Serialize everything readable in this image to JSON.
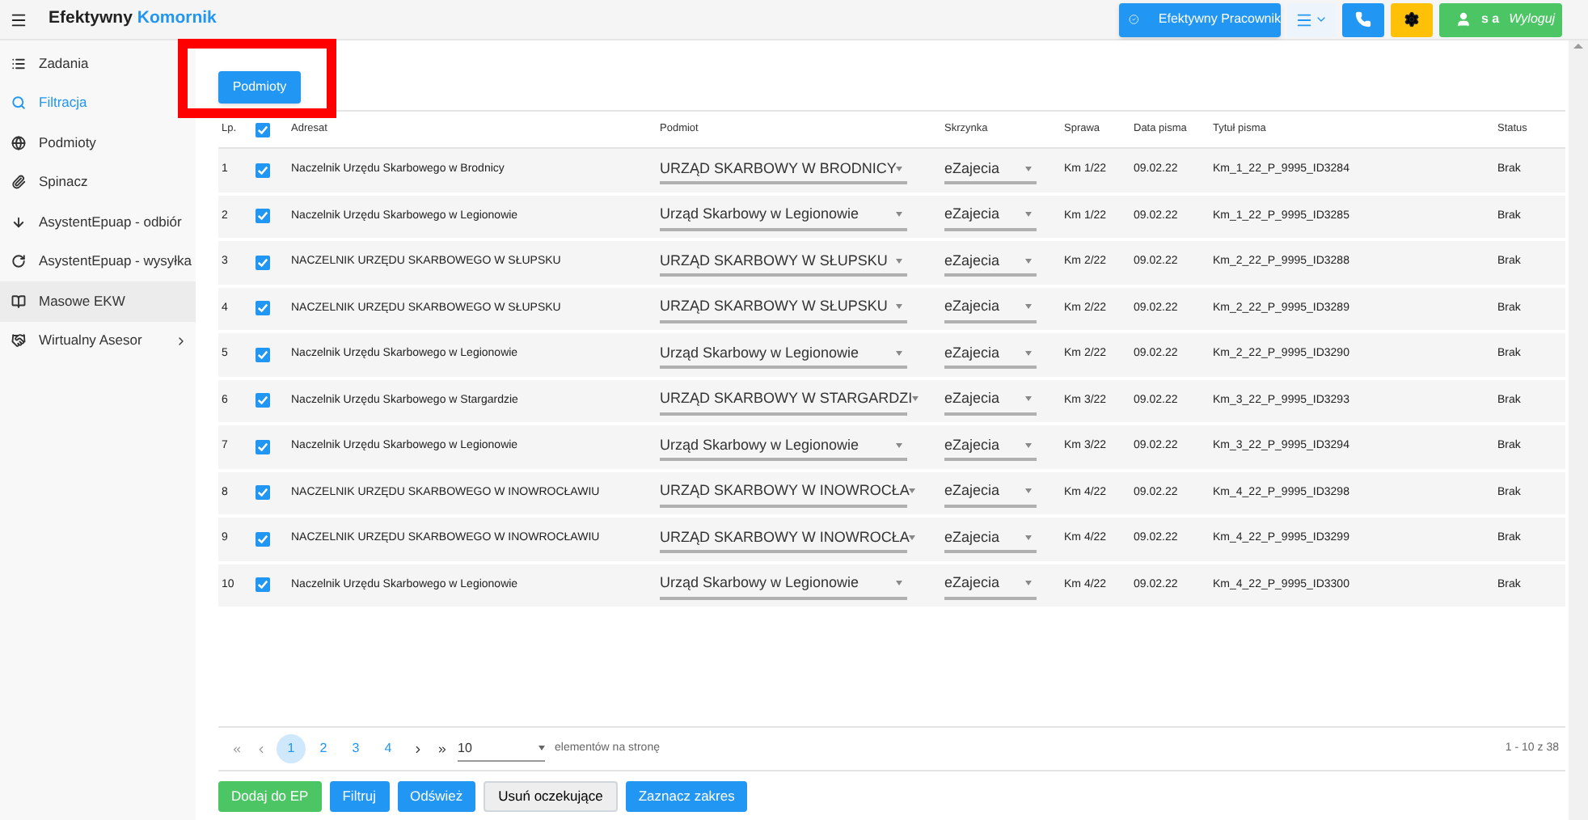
{
  "app": {
    "title_part1": "Efektywny",
    "title_part2": "Komornik"
  },
  "header_buttons": [
    {
      "kind": "primary",
      "label": "Efektywny Pracownik"
    },
    {
      "kind": "menu"
    },
    {
      "kind": "phone"
    },
    {
      "kind": "settings"
    },
    {
      "kind": "user",
      "user": "s a",
      "action": "Wyloguj"
    }
  ],
  "sidebar": {
    "items": [
      {
        "label": "Zadania",
        "selected": false,
        "highlighted": false
      },
      {
        "label": "Filtracja",
        "selected": true,
        "highlighted": false
      },
      {
        "label": "Podmioty",
        "selected": false,
        "highlighted": false
      },
      {
        "label": "Spinacz",
        "selected": false,
        "highlighted": false
      },
      {
        "label": "AsystentEpuap - odbiór",
        "selected": false,
        "highlighted": false
      },
      {
        "label": "AsystentEpuap - wysyłka",
        "selected": false,
        "highlighted": false
      },
      {
        "label": "Masowe EKW",
        "selected": false,
        "highlighted": true
      },
      {
        "label": "Wirtualny Asesor",
        "selected": false,
        "highlighted": false,
        "has_children": true
      }
    ]
  },
  "top_button": "Podmioty",
  "table": {
    "columns": [
      "Lp.",
      "Adresat",
      "Podmiot",
      "Skrzynka",
      "Sprawa",
      "Data pisma",
      "Tytuł pisma",
      "Status"
    ],
    "all_checked": true,
    "rows": [
      {
        "lp": "1",
        "checked": true,
        "adresat": "Naczelnik Urzędu Skarbowego w Brodnicy",
        "podmiot": "URZĄD SKARBOWY W BRODNICY",
        "skrzynka": "eZajecia",
        "sprawa": "Km 1/22",
        "data": "09.02.22",
        "tytul": "Km_1_22_P_9995_ID3284",
        "status": "Brak"
      },
      {
        "lp": "2",
        "checked": true,
        "adresat": "Naczelnik Urzędu Skarbowego w Legionowie",
        "podmiot": "Urząd Skarbowy w Legionowie",
        "skrzynka": "eZajecia",
        "sprawa": "Km 1/22",
        "data": "09.02.22",
        "tytul": "Km_1_22_P_9995_ID3285",
        "status": "Brak"
      },
      {
        "lp": "3",
        "checked": true,
        "adresat": "NACZELNIK URZĘDU SKARBOWEGO W SŁUPSKU",
        "podmiot": "URZĄD SKARBOWY W SŁUPSKU",
        "skrzynka": "eZajecia",
        "sprawa": "Km 2/22",
        "data": "09.02.22",
        "tytul": "Km_2_22_P_9995_ID3288",
        "status": "Brak"
      },
      {
        "lp": "4",
        "checked": true,
        "adresat": "NACZELNIK URZĘDU SKARBOWEGO W SŁUPSKU",
        "podmiot": "URZĄD SKARBOWY W SŁUPSKU",
        "skrzynka": "eZajecia",
        "sprawa": "Km 2/22",
        "data": "09.02.22",
        "tytul": "Km_2_22_P_9995_ID3289",
        "status": "Brak"
      },
      {
        "lp": "5",
        "checked": true,
        "adresat": "Naczelnik Urzędu Skarbowego w Legionowie",
        "podmiot": "Urząd Skarbowy w Legionowie",
        "skrzynka": "eZajecia",
        "sprawa": "Km 2/22",
        "data": "09.02.22",
        "tytul": "Km_2_22_P_9995_ID3290",
        "status": "Brak"
      },
      {
        "lp": "6",
        "checked": true,
        "adresat": "Naczelnik Urzędu Skarbowego w Stargardzie",
        "podmiot": "URZĄD SKARBOWY W STARGARDZI",
        "skrzynka": "eZajecia",
        "sprawa": "Km 3/22",
        "data": "09.02.22",
        "tytul": "Km_3_22_P_9995_ID3293",
        "status": "Brak"
      },
      {
        "lp": "7",
        "checked": true,
        "adresat": "Naczelnik Urzędu Skarbowego w Legionowie",
        "podmiot": "Urząd Skarbowy w Legionowie",
        "skrzynka": "eZajecia",
        "sprawa": "Km 3/22",
        "data": "09.02.22",
        "tytul": "Km_3_22_P_9995_ID3294",
        "status": "Brak"
      },
      {
        "lp": "8",
        "checked": true,
        "adresat": "NACZELNIK URZĘDU SKARBOWEGO W INOWROCŁAWIU",
        "podmiot": "URZĄD SKARBOWY W INOWROCŁA",
        "skrzynka": "eZajecia",
        "sprawa": "Km 4/22",
        "data": "09.02.22",
        "tytul": "Km_4_22_P_9995_ID3298",
        "status": "Brak"
      },
      {
        "lp": "9",
        "checked": true,
        "adresat": "NACZELNIK URZĘDU SKARBOWEGO W INOWROCŁAWIU",
        "podmiot": "URZĄD SKARBOWY W INOWROCŁA",
        "skrzynka": "eZajecia",
        "sprawa": "Km 4/22",
        "data": "09.02.22",
        "tytul": "Km_4_22_P_9995_ID3299",
        "status": "Brak"
      },
      {
        "lp": "10",
        "checked": true,
        "adresat": "Naczelnik Urzędu Skarbowego w Legionowie",
        "podmiot": "Urząd Skarbowy w Legionowie",
        "skrzynka": "eZajecia",
        "sprawa": "Km 4/22",
        "data": "09.02.22",
        "tytul": "Km_4_22_P_9995_ID3300",
        "status": "Brak"
      }
    ]
  },
  "pagination": {
    "pages": [
      {
        "label": "1",
        "selected": true
      },
      {
        "label": "2",
        "selected": false
      },
      {
        "label": "3",
        "selected": false
      },
      {
        "label": "4",
        "selected": false
      }
    ],
    "page_size": "10",
    "page_size_label": "elementów na stronę",
    "range": "1 - 10 z 38"
  },
  "actions": [
    {
      "label": "Dodaj do EP",
      "kind": "success"
    },
    {
      "label": "Filtruj",
      "kind": "primary"
    },
    {
      "label": "Odśwież",
      "kind": "primary"
    },
    {
      "label": "Usuń oczekujące",
      "kind": "default"
    },
    {
      "label": "Zaznacz zakres",
      "kind": "primary"
    }
  ]
}
